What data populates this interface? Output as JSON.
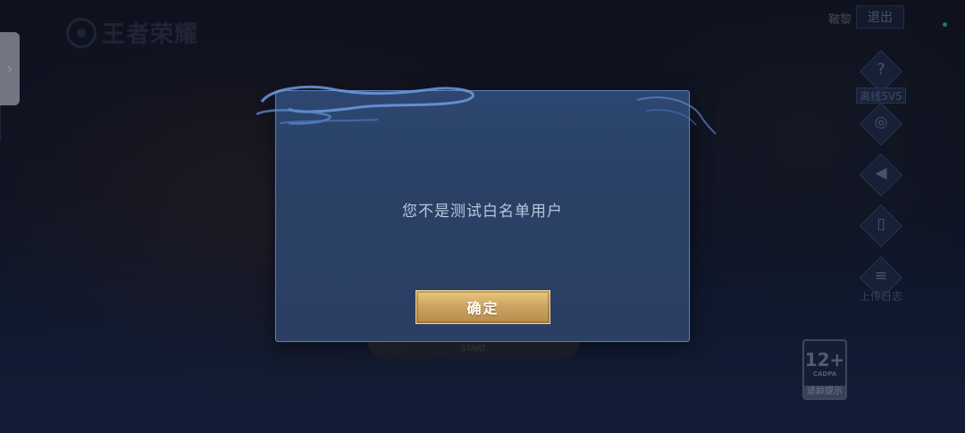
{
  "app": {
    "logo_text": "王者荣耀"
  },
  "top_right": {
    "user_name": "鞁黎",
    "exit_label": "退出"
  },
  "side_menu": {
    "mode_label": "离线5V5",
    "upload_log_label": "上传日志"
  },
  "age_rating": {
    "number": "12+",
    "org": "CADPA",
    "tip": "适龄提示"
  },
  "start_label": "START",
  "dialog": {
    "message": "您不是测试白名单用户",
    "confirm_label": "确定"
  },
  "colors": {
    "dialog_bg": "#2b4468",
    "dialog_border": "#5b7fb4",
    "confirm_gold": "#caa260",
    "status_green": "#21e07a"
  },
  "icons": [
    "chevron-right-icon",
    "help-icon",
    "camera-icon",
    "volume-icon",
    "phone-switch-icon",
    "clipboard-icon"
  ]
}
